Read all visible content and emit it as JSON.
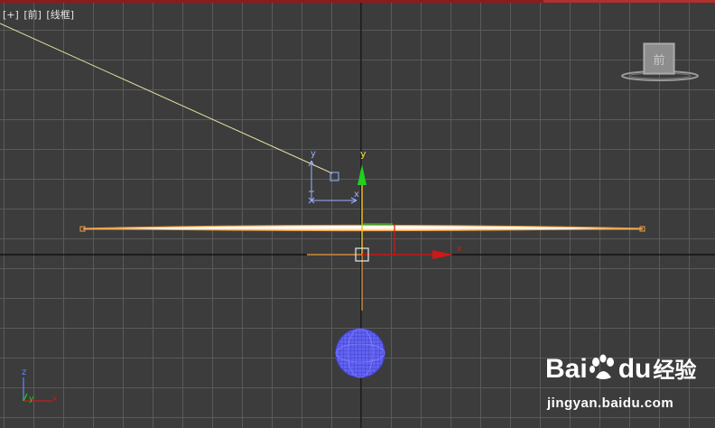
{
  "viewport": {
    "label_parts": [
      "[+]",
      "[前]",
      "[线框]"
    ]
  },
  "viewcube": {
    "face_label": "前"
  },
  "light_gizmo": {
    "axis_y": "y",
    "axis_x": "x"
  },
  "transform_gizmo": {
    "axis_y": "y",
    "axis_x": "x"
  },
  "world_axis": {
    "axis_z": "z",
    "axis_y": "y",
    "axis_x": "x"
  },
  "watermark": {
    "brand_prefix": "Bai",
    "brand_suffix": "du",
    "brand_cn": "经验",
    "url": "jingyan.baidu.com"
  },
  "colors": {
    "background": "#3c3c3c",
    "grid": "#5a5a5a",
    "origin_axis": "#0a0a0a",
    "gizmo_y": "#1fd01f",
    "gizmo_x": "#d01818",
    "selection": "#f0a040",
    "light_line": "#e6e0a0",
    "sphere": "#5a5ae8",
    "target_gizmo": "#9ab0ff"
  }
}
